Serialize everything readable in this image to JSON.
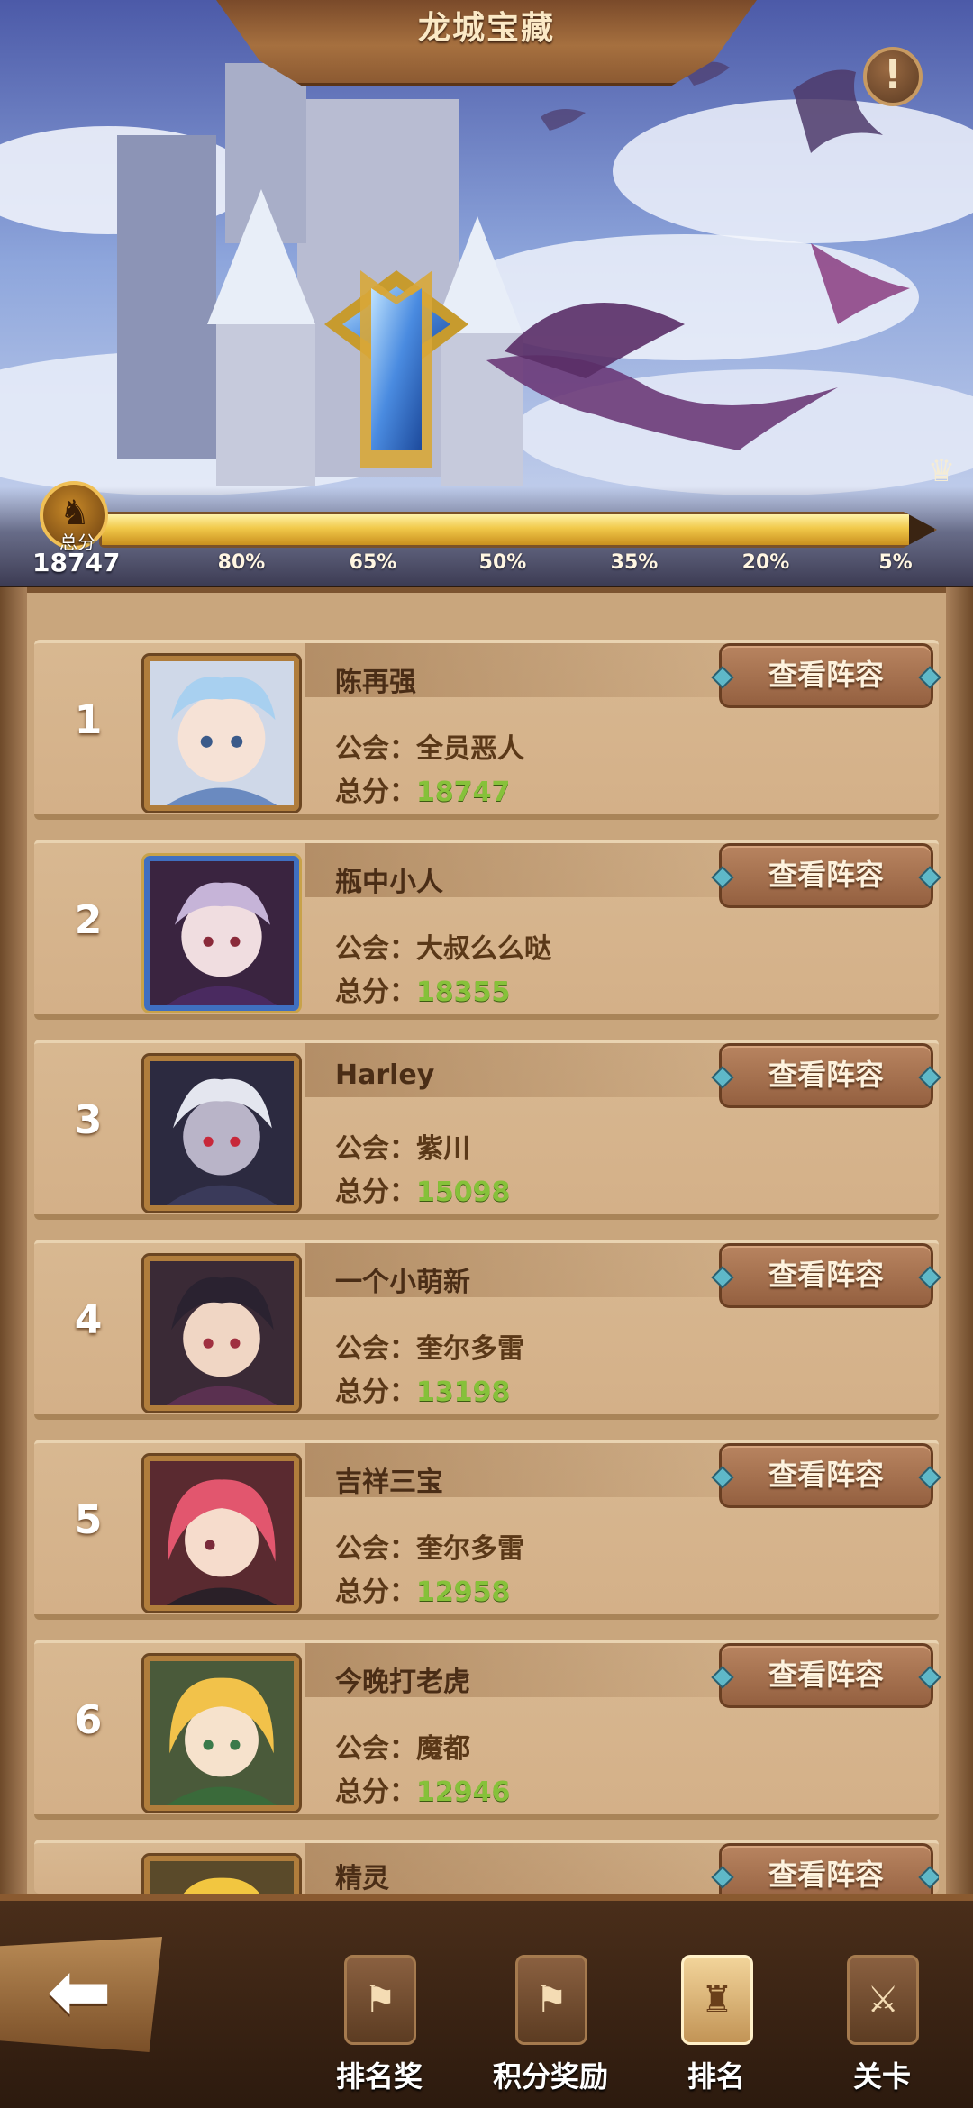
{
  "header": {
    "title": "龙城宝藏",
    "info_icon": "exclamation-icon"
  },
  "progress": {
    "badge_label": "总分",
    "total_score": "18747",
    "fill_fraction": 0.97,
    "ticks": [
      "80%",
      "65%",
      "50%",
      "35%",
      "20%",
      "5%"
    ]
  },
  "ranking": {
    "guild_key": "公会：",
    "score_key": "总分：",
    "view_label": "查看阵容",
    "rows": [
      {
        "rank": "1",
        "name": "陈再强",
        "guild": "全员恶人",
        "score": "18747"
      },
      {
        "rank": "2",
        "name": "瓶中小人",
        "guild": "大叔么么哒",
        "score": "18355"
      },
      {
        "rank": "3",
        "name": "Harley",
        "guild": "紫川",
        "score": "15098"
      },
      {
        "rank": "4",
        "name": "一个小萌新",
        "guild": "奎尔多雷",
        "score": "13198"
      },
      {
        "rank": "5",
        "name": "吉祥三宝",
        "guild": "奎尔多雷",
        "score": "12958"
      },
      {
        "rank": "6",
        "name": "今晚打老虎",
        "guild": "魔都",
        "score": "12946"
      },
      {
        "rank": "",
        "name": "精灵",
        "guild": "",
        "score": ""
      }
    ]
  },
  "nav": {
    "back_icon": "back-arrow-icon",
    "items": [
      {
        "label": "排名奖",
        "icon": "banner-icon"
      },
      {
        "label": "积分奖励",
        "icon": "banner-icon"
      },
      {
        "label": "排名",
        "icon": "trophy-banner-icon",
        "active": true
      },
      {
        "label": "关卡",
        "icon": "crossed-swords-icon"
      }
    ]
  }
}
